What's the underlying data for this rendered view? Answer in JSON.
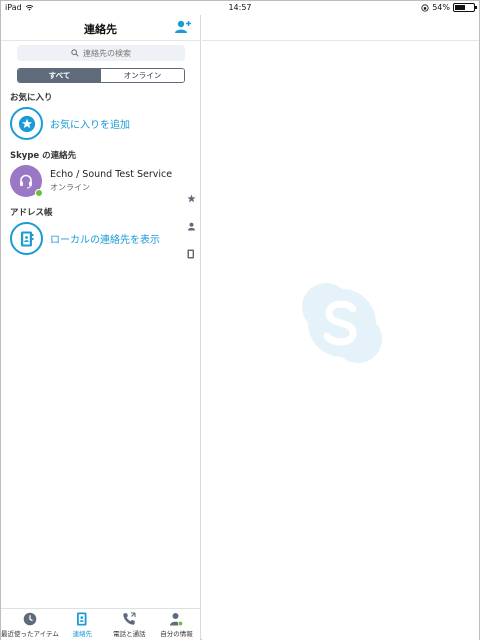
{
  "statusbar": {
    "device": "iPad",
    "time": "14:57",
    "battery_text": "54%",
    "battery_level": 0.54
  },
  "contacts_pane": {
    "title": "連絡先",
    "search_placeholder": "連絡先の検索",
    "segments": [
      {
        "label": "すべて",
        "active": true
      },
      {
        "label": "オンライン",
        "active": false
      }
    ],
    "favorites": {
      "section_label": "お気に入り",
      "add_label": "お気に入りを追加"
    },
    "skype_contacts": {
      "section_label": "Skype の連絡先",
      "items": [
        {
          "name": "Echo / Sound Test Service",
          "status": "オンライン"
        }
      ]
    },
    "address_book": {
      "section_label": "アドレス帳",
      "show_local_label": "ローカルの連絡先を表示"
    }
  },
  "tabbar": {
    "tabs": [
      {
        "label": "最近使ったアイテム",
        "icon": "clock-icon",
        "active": false
      },
      {
        "label": "連絡先",
        "icon": "contacts-book-icon",
        "active": true
      },
      {
        "label": "電話と通話",
        "icon": "phone-icon",
        "active": false
      },
      {
        "label": "自分の情報",
        "icon": "person-icon",
        "active": false
      }
    ]
  },
  "colors": {
    "accent": "#1a9bd7",
    "segment_active": "#5f6b7a",
    "avatar": "#9a78c6",
    "online": "#6bbf3b",
    "watermark": "#e6f2f9"
  }
}
